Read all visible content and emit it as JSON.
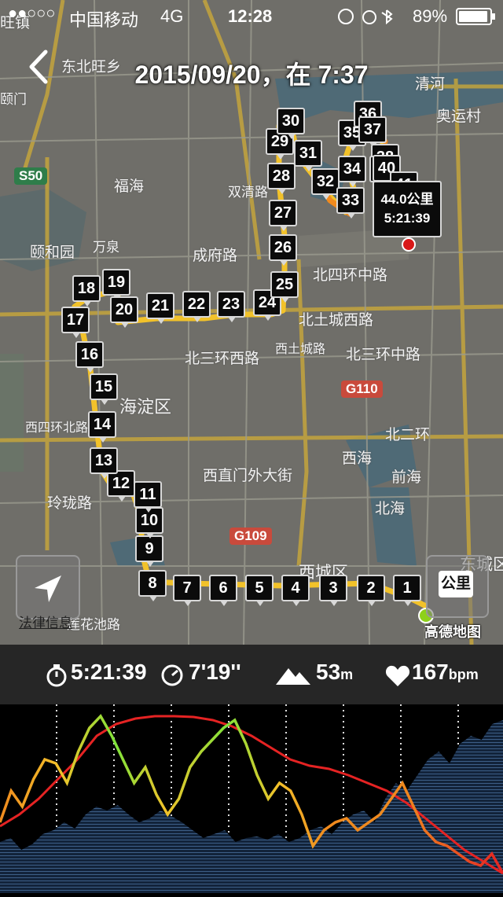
{
  "status_bar": {
    "signal": "●●○○○",
    "carrier": "中国移动",
    "network": "4G",
    "time": "12:28",
    "battery": "89%"
  },
  "header": {
    "title": "2015/09/20，在 7:37"
  },
  "map": {
    "end_callout": {
      "distance": "44.0公里",
      "duration": "5:21:39"
    },
    "unit_button": "公里",
    "legal_link": "法律信息",
    "provider_logo": "高德地图",
    "place_labels": [
      "东北旺乡",
      "奥运村",
      "福海",
      "颐和园",
      "成府路",
      "双清路",
      "北四环中路",
      "北土城西路",
      "北三环西路",
      "北三环中路",
      "西土城路",
      "海淀区",
      "北二环",
      "西海",
      "前海",
      "西直门外大街",
      "玲珑路",
      "西四环北路",
      "万泉",
      "西城区",
      "东城区",
      "北海",
      "清河",
      "莲花池路",
      "旺镇",
      "颐门"
    ],
    "road_shields": [
      "S50",
      "G110",
      "G109"
    ],
    "km_markers": [
      "1",
      "2",
      "3",
      "4",
      "5",
      "6",
      "7",
      "8",
      "9",
      "10",
      "11",
      "12",
      "13",
      "14",
      "15",
      "16",
      "17",
      "18",
      "19",
      "20",
      "21",
      "22",
      "23",
      "24",
      "25",
      "26",
      "27",
      "28",
      "29",
      "30",
      "31",
      "32",
      "33",
      "34",
      "35",
      "36",
      "37",
      "38",
      "39",
      "40",
      "41"
    ]
  },
  "stats": {
    "duration": "5:21:39",
    "pace": "7'19''",
    "elevation_value": "53",
    "elevation_unit": "m",
    "heart_rate_value": "167",
    "heart_rate_unit": "bpm"
  },
  "colors": {
    "route": "#f2c22a",
    "pace_good": "#7fe33a",
    "pace_mid": "#f2c22a",
    "pace_slow": "#f08a1e",
    "heart_rate": "#e52323",
    "elevation": "#2d4a6b"
  }
}
